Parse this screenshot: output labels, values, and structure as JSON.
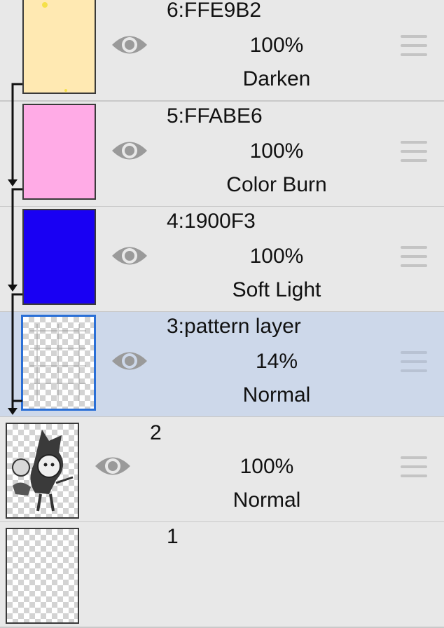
{
  "layers": [
    {
      "name": "6:FFE9B2",
      "opacity": "100%",
      "blend": "Darken",
      "color": "#FFE9B2"
    },
    {
      "name": "5:FFABE6",
      "opacity": "100%",
      "blend": "Color Burn",
      "color": "#FFABE6"
    },
    {
      "name": "4:1900F3",
      "opacity": "100%",
      "blend": "Soft Light",
      "color": "#1900F3"
    },
    {
      "name": "3:pattern layer",
      "opacity": "14%",
      "blend": "Normal",
      "selected": true
    },
    {
      "name": "2",
      "opacity": "100%",
      "blend": "Normal"
    },
    {
      "name": "1"
    }
  ],
  "icons": {
    "visibility": "eye-icon",
    "reorder": "drag-handle-icon",
    "clipping": "clipping-arrow-icon"
  },
  "colors": {
    "background": "#e8e8e8",
    "selected_background": "#cdd8ea",
    "selection_border": "#2a6fd6"
  }
}
